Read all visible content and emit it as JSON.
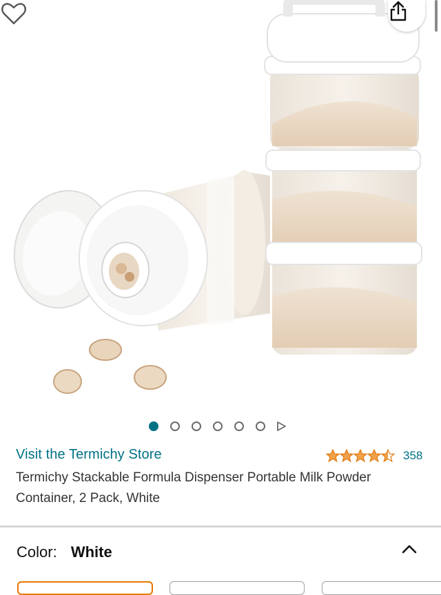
{
  "product": {
    "store_link": "Visit the Termichy Store",
    "rating": 4.5,
    "rating_count": "358",
    "title": "Termichy Stackable Formula Dispenser Portable Milk Powder Container, 2 Pack, White"
  },
  "gallery": {
    "image_count": 6,
    "active_index": 0,
    "has_video": true
  },
  "variation": {
    "label": "Color:",
    "selected": "White"
  },
  "colors": {
    "accent_link": "#007185",
    "star": "#f0a14b",
    "selected_border": "#e77600"
  },
  "icons": {
    "share": "share-icon",
    "wishlist": "heart-icon",
    "collapse": "chevron-up-icon",
    "video": "play-icon"
  }
}
